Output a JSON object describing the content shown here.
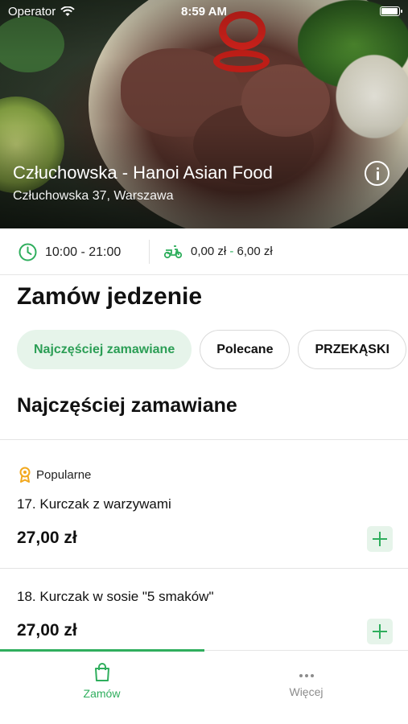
{
  "status_bar": {
    "carrier": "Operator",
    "time": "8:59 AM",
    "battery_level": 0.95
  },
  "restaurant": {
    "name": "Człuchowska - Hanoi Asian Food",
    "address": "Człuchowska 37, Warszawa",
    "hours": "10:00 - 21:00",
    "delivery_min": "0,00 zł",
    "delivery_dash": "-",
    "delivery_max": "6,00 zł"
  },
  "icons": {
    "info": "info-icon",
    "clock": "clock-icon",
    "delivery": "scooter-icon",
    "badge": "award-ribbon-icon",
    "add": "plus-icon",
    "order_tab": "shopping-bag-icon",
    "more_tab": "more-dots-icon"
  },
  "colors": {
    "accent": "#2fae5d",
    "chip_active_bg": "#e6f4ea",
    "badge_icon": "#f2a81d"
  },
  "page": {
    "title": "Zamów jedzenie"
  },
  "categories": [
    {
      "label": "Najczęściej zamawiane",
      "active": true
    },
    {
      "label": "Polecane",
      "active": false
    },
    {
      "label": "PRZEKĄSKI",
      "active": false
    }
  ],
  "current_category": "Najczęściej zamawiane",
  "menu_items": [
    {
      "badge": "Popularne",
      "name": "17. Kurczak z warzywami",
      "price": "27,00 zł"
    },
    {
      "name": "18. Kurczak w sosie \"5 smaków\"",
      "price": "27,00 zł"
    }
  ],
  "tabbar": {
    "order": "Zamów",
    "more": "Więcej"
  }
}
